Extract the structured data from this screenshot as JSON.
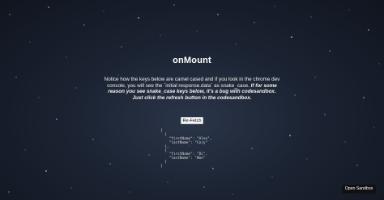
{
  "page": {
    "title": "onMount",
    "notice_plain": "Notice how the keys below are camel cased and if you look in the chrome dev console, you will see the `initial response.data` as snake_case.",
    "notice_bold": "If for some reason you see snake_case keys below, it's a bug with codesandbox. Just click the refresh button in the codesandbox.",
    "refetch_label": "Re-Fetch",
    "json_output": "[\n  {\n    \"firstName\": \"Alex\",\n    \"lastName\": \"Cory\"\n  },\n  {\n    \"firstName\": \"Di\",\n    \"lastName\": \"Won\"\n  }\n]"
  },
  "sandbox": {
    "open_label": "Open Sandbox"
  }
}
